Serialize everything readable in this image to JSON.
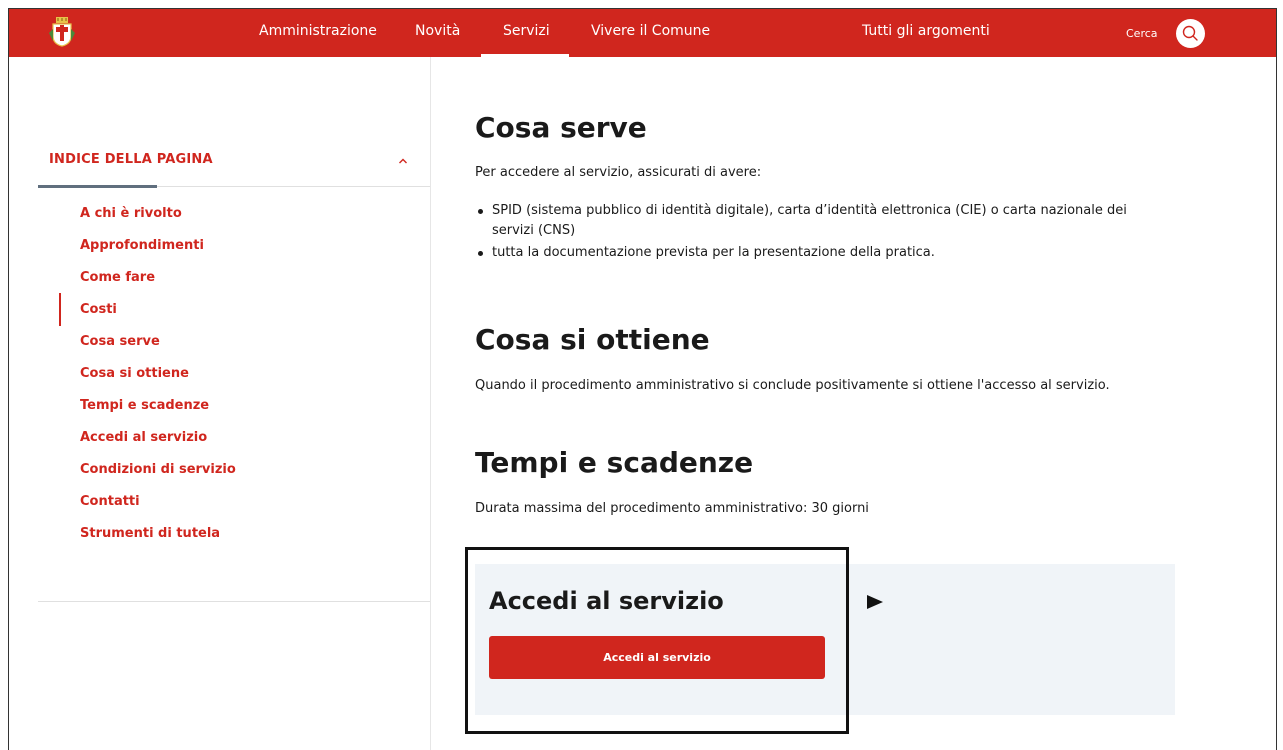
{
  "header": {
    "logo_icon": "municipal-coat-of-arms-icon",
    "nav": [
      {
        "label": "Amministrazione"
      },
      {
        "label": "Novità"
      },
      {
        "label": "Servizi",
        "active": true
      },
      {
        "label": "Vivere il Comune"
      },
      {
        "label": "Tutti gli argomenti"
      }
    ],
    "search_label": "Cerca",
    "search_icon": "search-icon"
  },
  "sidebar": {
    "title": "INDICE DELLA PAGINA",
    "collapse_icon": "chevron-up-icon",
    "items": [
      {
        "label": "A chi è rivolto"
      },
      {
        "label": "Approfondimenti"
      },
      {
        "label": "Come fare"
      },
      {
        "label": "Costi",
        "active": true
      },
      {
        "label": "Cosa serve"
      },
      {
        "label": "Cosa si ottiene"
      },
      {
        "label": "Tempi e scadenze"
      },
      {
        "label": "Accedi al servizio"
      },
      {
        "label": "Condizioni di servizio"
      },
      {
        "label": "Contatti"
      },
      {
        "label": "Strumenti di tutela"
      }
    ]
  },
  "main": {
    "cosa_serve": {
      "title": "Cosa serve",
      "intro": "Per accedere al servizio, assicurati di avere:",
      "bullets": [
        "SPID (sistema pubblico di identità digitale), carta d’identità elettronica (CIE) o carta nazionale dei servizi (CNS)",
        "tutta la documentazione prevista per la presentazione della pratica."
      ]
    },
    "cosa_si_ottiene": {
      "title": "Cosa si ottiene",
      "text": "Quando il procedimento amministrativo si conclude positivamente si ottiene l'accesso al servizio."
    },
    "tempi_e_scadenze": {
      "title": "Tempi e scadenze",
      "text": "Durata massima del procedimento amministrativo: 30 giorni"
    },
    "accedi": {
      "title": "Accedi al servizio",
      "button_label": "Accedi al servizio"
    }
  },
  "colors": {
    "brand_red": "#d0261e",
    "panel_bg": "#f0f4f8",
    "toc_indicator": "#606f7e"
  }
}
